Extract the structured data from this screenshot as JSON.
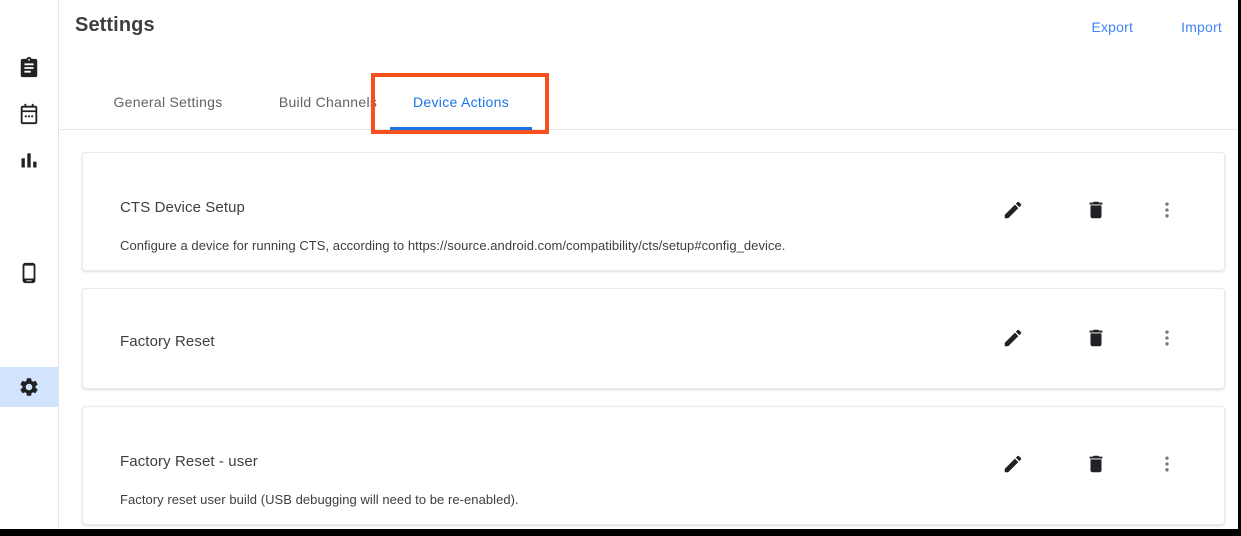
{
  "app": {
    "page_title": "Settings"
  },
  "sidebar": {
    "items": [
      {
        "icon": "clipboard-icon",
        "name": "test-runs",
        "active": false
      },
      {
        "icon": "calendar-icon",
        "name": "schedules",
        "active": false
      },
      {
        "icon": "bar-chart-icon",
        "name": "reports",
        "active": false
      },
      {
        "icon": "smartphone-icon",
        "name": "devices",
        "active": false
      },
      {
        "icon": "gear-icon",
        "name": "settings",
        "active": true
      }
    ],
    "highlight_color": "#d2e3fc"
  },
  "header": {
    "export_label": "Export",
    "import_label": "Import",
    "link_color": "#4285f4"
  },
  "tabs": {
    "active_index": 2,
    "active_color": "#1a73e8",
    "inactive_color": "#5f6368",
    "items": [
      {
        "label": "General Settings"
      },
      {
        "label": "Build Channels"
      },
      {
        "label": "Device Actions"
      }
    ]
  },
  "annotation": {
    "target": "Device Actions",
    "color": "#f4511e"
  },
  "device_actions": {
    "cards": [
      {
        "title": "CTS Device Setup",
        "description": "Configure a device for running CTS, according to https://source.android.com/compatibility/cts/setup#config_device.",
        "edit_icon": "pencil-icon",
        "delete_icon": "trash-icon",
        "more_icon": "more-vert-icon"
      },
      {
        "title": "Factory Reset",
        "description": "",
        "edit_icon": "pencil-icon",
        "delete_icon": "trash-icon",
        "more_icon": "more-vert-icon"
      },
      {
        "title": "Factory Reset - user",
        "description": "Factory reset user build (USB debugging will need to be re-enabled).",
        "edit_icon": "pencil-icon",
        "delete_icon": "trash-icon",
        "more_icon": "more-vert-icon"
      }
    ]
  }
}
